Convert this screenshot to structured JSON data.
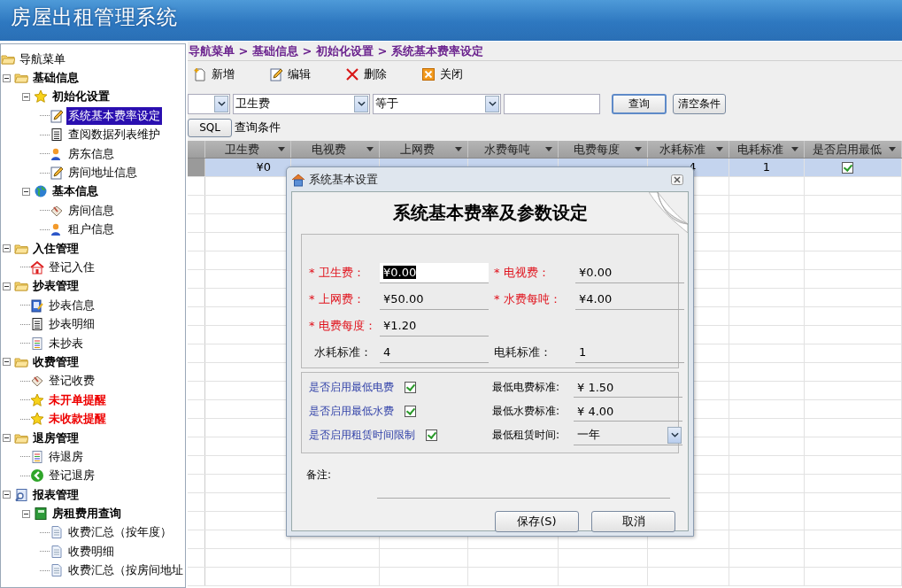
{
  "app": {
    "title": "房屋出租管理系统"
  },
  "nav": {
    "root": {
      "label": "导航菜单",
      "kind": "folder"
    },
    "items": [
      {
        "label": "基础信息",
        "kind": "folder",
        "expanded": true,
        "selected": false,
        "alert": false,
        "children": [
          {
            "label": "初始化设置",
            "kind": "star",
            "expanded": true,
            "selected": false,
            "alert": false,
            "children": [
              {
                "label": "系统基本费率设定",
                "kind": "edit",
                "selected": true,
                "alert": false
              },
              {
                "label": "查阅数据列表维护",
                "kind": "list",
                "selected": false,
                "alert": false
              },
              {
                "label": "房东信息",
                "kind": "user",
                "selected": false,
                "alert": false
              },
              {
                "label": "房间地址信息",
                "kind": "edit",
                "selected": false,
                "alert": false
              }
            ]
          },
          {
            "label": "基本信息",
            "kind": "globe",
            "expanded": true,
            "selected": false,
            "alert": false,
            "children": [
              {
                "label": "房间信息",
                "kind": "box",
                "selected": false,
                "alert": false
              },
              {
                "label": "租户信息",
                "kind": "user",
                "selected": false,
                "alert": false
              }
            ]
          }
        ]
      },
      {
        "label": "入住管理",
        "kind": "folder",
        "expanded": true,
        "selected": false,
        "alert": false,
        "children": [
          {
            "label": "登记入住",
            "kind": "house",
            "selected": false,
            "alert": false
          }
        ]
      },
      {
        "label": "抄表管理",
        "kind": "folder",
        "expanded": true,
        "selected": false,
        "alert": false,
        "children": [
          {
            "label": "抄表信息",
            "kind": "meter",
            "selected": false,
            "alert": false
          },
          {
            "label": "抄表明细",
            "kind": "list",
            "selected": false,
            "alert": false
          },
          {
            "label": "未抄表",
            "kind": "doc",
            "selected": false,
            "alert": false
          }
        ]
      },
      {
        "label": "收费管理",
        "kind": "folder",
        "expanded": true,
        "selected": false,
        "alert": false,
        "children": [
          {
            "label": "登记收费",
            "kind": "box",
            "selected": false,
            "alert": false
          },
          {
            "label": "未开单提醒",
            "kind": "star",
            "selected": false,
            "alert": true
          },
          {
            "label": "未收款提醒",
            "kind": "star",
            "selected": false,
            "alert": true
          }
        ]
      },
      {
        "label": "退房管理",
        "kind": "folder",
        "expanded": true,
        "selected": false,
        "alert": false,
        "children": [
          {
            "label": "待退房",
            "kind": "doc",
            "selected": false,
            "alert": false
          },
          {
            "label": "登记退房",
            "kind": "back",
            "selected": false,
            "alert": false
          }
        ]
      },
      {
        "label": "报表管理",
        "kind": "report",
        "expanded": true,
        "selected": false,
        "alert": false,
        "children": [
          {
            "label": "房租费用查询",
            "kind": "book",
            "expanded": true,
            "selected": false,
            "alert": false,
            "children": [
              {
                "label": "收费汇总（按年度）",
                "kind": "page",
                "selected": false,
                "alert": false
              },
              {
                "label": "收费明细",
                "kind": "page",
                "selected": false,
                "alert": false
              },
              {
                "label": "收费汇总（按房间地址",
                "kind": "page",
                "selected": false,
                "alert": false
              }
            ]
          }
        ]
      }
    ]
  },
  "breadcrumb": "导航菜单 > 基础信息 > 初始化设置 > 系统基本费率设定",
  "toolbar": [
    {
      "label": "新增",
      "kind": "new"
    },
    {
      "label": "编辑",
      "kind": "edit"
    },
    {
      "label": "删除",
      "kind": "delete"
    },
    {
      "label": "关闭",
      "kind": "close"
    }
  ],
  "filter": {
    "field": "卫生费",
    "operator": "等于",
    "search_button": "查询",
    "clear_button": "清空条件",
    "sql_button": "SQL",
    "condition_label": "查询条件"
  },
  "grid": {
    "columns": [
      "卫生费",
      "电视费",
      "上网费",
      "水费每吨",
      "电费每度",
      "水耗标准",
      "电耗标准",
      "是否启用最低"
    ],
    "rows": [
      {
        "selected": true,
        "cells": [
          "¥0",
          null,
          null,
          null,
          null,
          "4",
          "1"
        ],
        "checked": true
      }
    ]
  },
  "dialog": {
    "title": "系统基本设置",
    "heading": "系统基本费率及参数设定",
    "field_rows": [
      [
        {
          "label": "* 卫生费：",
          "value": "¥0.00",
          "required": true,
          "focused": true
        },
        {
          "label": "* 电视费：",
          "value": "¥0.00",
          "required": true,
          "focused": false
        }
      ],
      [
        {
          "label": "* 上网费：",
          "value": "¥50.00",
          "required": true,
          "focused": false
        },
        {
          "label": "* 水费每吨：",
          "value": "¥4.00",
          "required": true,
          "focused": false
        }
      ],
      [
        {
          "label": "* 电费每度：",
          "value": "¥1.20",
          "required": true,
          "focused": false
        }
      ],
      [
        {
          "label": "水耗标准：",
          "value": "4",
          "required": false,
          "focused": false
        },
        {
          "label": "电耗标准：",
          "value": "1",
          "required": false,
          "focused": false
        }
      ]
    ],
    "options": [
      {
        "label": "是否启用最低电费",
        "checked": true,
        "setting_label": "最低电费标准:",
        "setting_value": "¥ 1.50",
        "kind": "text"
      },
      {
        "label": "是否启用最低水费",
        "checked": true,
        "setting_label": "最低水费标准:",
        "setting_value": "¥ 4.00",
        "kind": "text"
      },
      {
        "label": "是否启用租赁时间限制",
        "checked": true,
        "setting_label": "最低租赁时间:",
        "setting_value": "一年",
        "kind": "dropdown"
      }
    ],
    "note_label": "备注:",
    "buttons": [
      "保存(S)",
      "取消"
    ]
  }
}
